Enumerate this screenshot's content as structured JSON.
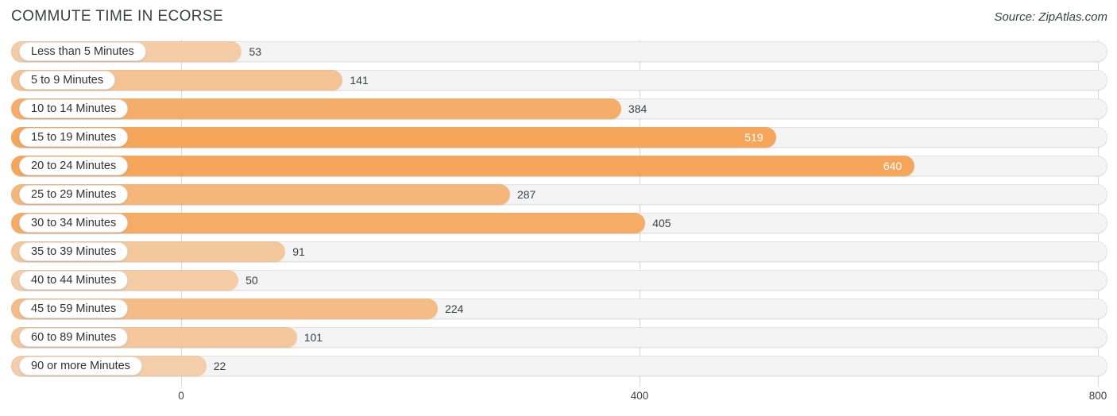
{
  "header": {
    "title": "COMMUTE TIME IN ECORSE",
    "source": "Source: ZipAtlas.com"
  },
  "chart_data": {
    "type": "bar",
    "orientation": "horizontal",
    "title": "COMMUTE TIME IN ECORSE",
    "subtitle": "",
    "xlabel": "",
    "ylabel": "",
    "xlim": [
      0,
      800
    ],
    "xticks": [
      0,
      400,
      800
    ],
    "xtick_labels": [
      "0",
      "400",
      "800"
    ],
    "grid": true,
    "legend": false,
    "source": "Source: ZipAtlas.com",
    "categories": [
      "Less than 5 Minutes",
      "5 to 9 Minutes",
      "10 to 14 Minutes",
      "15 to 19 Minutes",
      "20 to 24 Minutes",
      "25 to 29 Minutes",
      "30 to 34 Minutes",
      "35 to 39 Minutes",
      "40 to 44 Minutes",
      "45 to 59 Minutes",
      "60 to 89 Minutes",
      "90 or more Minutes"
    ],
    "values": [
      53,
      141,
      384,
      519,
      640,
      287,
      405,
      91,
      50,
      224,
      101,
      22
    ],
    "value_labels": [
      "53",
      "141",
      "384",
      "519",
      "640",
      "287",
      "405",
      "91",
      "50",
      "224",
      "101",
      "22"
    ],
    "label_placement": [
      "outside",
      "outside",
      "outside",
      "inside",
      "inside",
      "outside",
      "outside",
      "outside",
      "outside",
      "outside",
      "outside",
      "outside"
    ],
    "bar_color": "#f5a65a",
    "track_color": "#f4f4f4",
    "inside_label_color": "#ffffff",
    "outside_label_color": "#3c4043"
  }
}
